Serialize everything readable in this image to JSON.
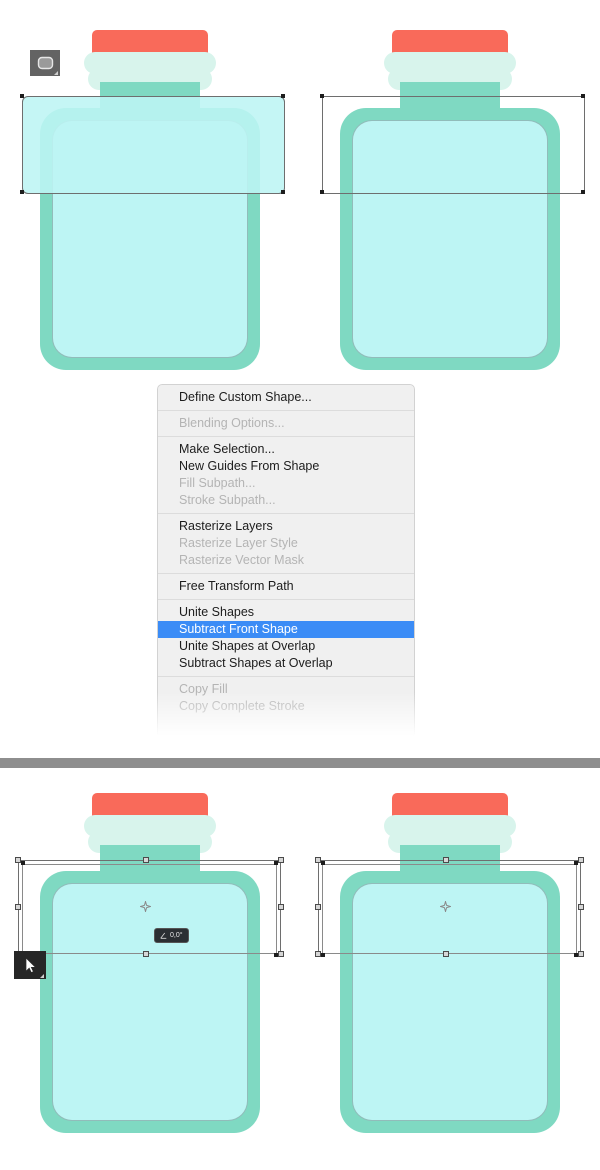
{
  "app": {
    "type": "image-editor-canvas",
    "colors": {
      "lid": "#f96a5a",
      "thread": "#d8f4ec",
      "jar_body": "#7fd9c2",
      "jar_liquid": "#bdf5f4",
      "menu_bg": "#f0f0f0",
      "menu_highlight": "#3b8cf6",
      "divider": "#8e8e8e",
      "path_outline": "#6e6e6e",
      "tool_chip": "#636363",
      "badge_bg": "#2b2f33"
    }
  },
  "panels": {
    "top": {
      "name": "step-1-panel",
      "figures": [
        {
          "name": "jar-with-overlay-rectangle",
          "caption": ""
        },
        {
          "name": "jar-with-path-selection",
          "caption": ""
        }
      ]
    },
    "bottom": {
      "name": "step-2-panel",
      "figures": [
        {
          "name": "jar-with-free-transform",
          "caption": ""
        },
        {
          "name": "jar-transform-result",
          "caption": ""
        }
      ]
    }
  },
  "tools": {
    "rounded_rectangle_tool": {
      "icon": "rounded-rectangle-icon",
      "label": "Rounded Rectangle Tool"
    },
    "path_selection_tool": {
      "icon": "path-selection-arrow-icon",
      "label": "Path Selection Tool"
    }
  },
  "transform_badge": {
    "icon": "rotation-angle-icon",
    "value": "0,0°"
  },
  "context_menu": {
    "name": "shape-context-menu",
    "groups": [
      {
        "items": [
          {
            "label": "Define Custom Shape...",
            "state": "enabled"
          }
        ]
      },
      {
        "items": [
          {
            "label": "Blending Options...",
            "state": "disabled"
          }
        ]
      },
      {
        "items": [
          {
            "label": "Make Selection...",
            "state": "enabled"
          },
          {
            "label": "New Guides From Shape",
            "state": "enabled"
          },
          {
            "label": "Fill Subpath...",
            "state": "disabled"
          },
          {
            "label": "Stroke Subpath...",
            "state": "disabled"
          }
        ]
      },
      {
        "items": [
          {
            "label": "Rasterize Layers",
            "state": "enabled"
          },
          {
            "label": "Rasterize Layer Style",
            "state": "disabled"
          },
          {
            "label": "Rasterize Vector Mask",
            "state": "disabled"
          }
        ]
      },
      {
        "items": [
          {
            "label": "Free Transform Path",
            "state": "enabled"
          }
        ]
      },
      {
        "items": [
          {
            "label": "Unite Shapes",
            "state": "enabled"
          },
          {
            "label": "Subtract Front Shape",
            "state": "selected"
          },
          {
            "label": "Unite Shapes at Overlap",
            "state": "enabled"
          },
          {
            "label": "Subtract Shapes at Overlap",
            "state": "enabled"
          }
        ]
      },
      {
        "items": [
          {
            "label": "Copy Fill",
            "state": "disabled"
          },
          {
            "label": "Copy Complete Stroke",
            "state": "disabled"
          }
        ]
      }
    ]
  }
}
